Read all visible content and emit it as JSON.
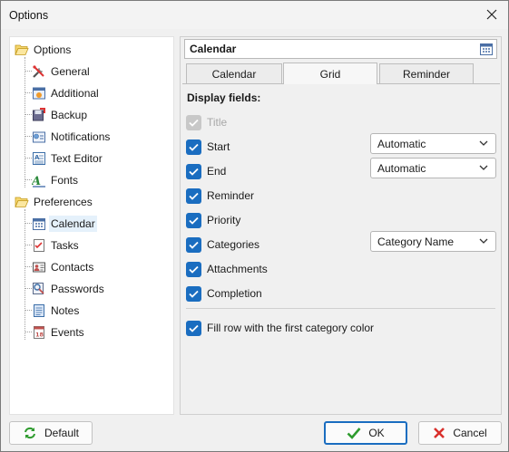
{
  "window": {
    "title": "Options"
  },
  "tree": {
    "groups": [
      {
        "label": "Options",
        "items": [
          {
            "label": "General",
            "icon": "tools-icon"
          },
          {
            "label": "Additional",
            "icon": "additional-icon"
          },
          {
            "label": "Backup",
            "icon": "backup-icon"
          },
          {
            "label": "Notifications",
            "icon": "notifications-icon"
          },
          {
            "label": "Text Editor",
            "icon": "text-editor-icon"
          },
          {
            "label": "Fonts",
            "icon": "fonts-icon"
          }
        ]
      },
      {
        "label": "Preferences",
        "items": [
          {
            "label": "Calendar",
            "icon": "calendar-icon",
            "selected": true
          },
          {
            "label": "Tasks",
            "icon": "tasks-icon"
          },
          {
            "label": "Contacts",
            "icon": "contacts-icon"
          },
          {
            "label": "Passwords",
            "icon": "passwords-icon"
          },
          {
            "label": "Notes",
            "icon": "notes-icon"
          },
          {
            "label": "Events",
            "icon": "events-icon"
          }
        ]
      }
    ]
  },
  "panel": {
    "header": "Calendar",
    "tabs": [
      {
        "label": "Calendar",
        "active": false
      },
      {
        "label": "Grid",
        "active": true
      },
      {
        "label": "Reminder",
        "active": false
      }
    ],
    "section_title": "Display fields:",
    "fields": [
      {
        "label": "Title",
        "checked": true,
        "disabled": true
      },
      {
        "label": "Start",
        "checked": true,
        "disabled": false
      },
      {
        "label": "End",
        "checked": true,
        "disabled": false
      },
      {
        "label": "Reminder",
        "checked": true,
        "disabled": false
      },
      {
        "label": "Priority",
        "checked": true,
        "disabled": false
      },
      {
        "label": "Categories",
        "checked": true,
        "disabled": false
      },
      {
        "label": "Attachments",
        "checked": true,
        "disabled": false
      },
      {
        "label": "Completion",
        "checked": true,
        "disabled": false
      }
    ],
    "start_format": "Automatic",
    "end_format": "Automatic",
    "categories_format": "Category Name",
    "fill_row_label": "Fill row with the first category color",
    "fill_row_checked": true
  },
  "buttons": {
    "default": "Default",
    "ok": "OK",
    "cancel": "Cancel"
  },
  "colors": {
    "accent": "#1a6dc0",
    "selection": "#e5f1fb",
    "ok_check": "#2e9b2e",
    "cancel_x": "#d9302c",
    "folder": "#f2c94c"
  }
}
